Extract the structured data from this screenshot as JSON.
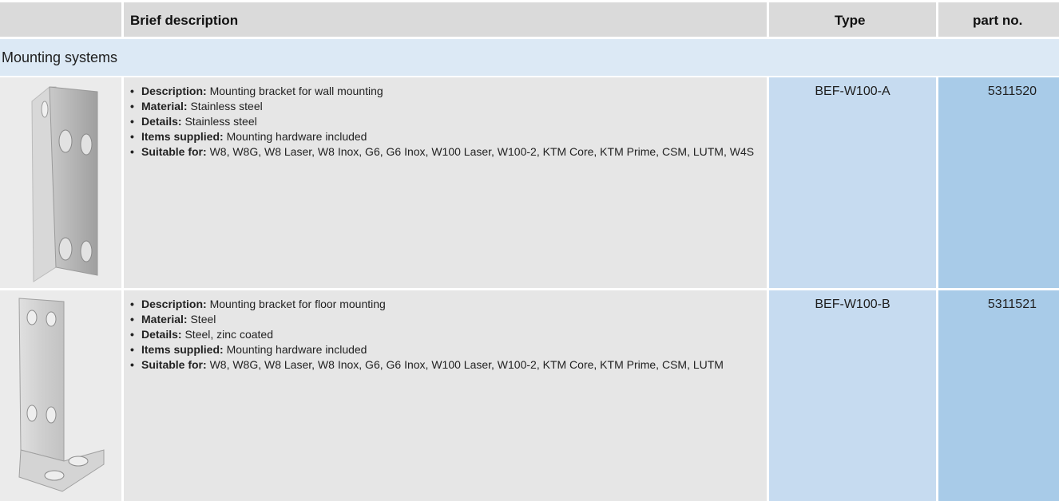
{
  "header": {
    "brief_description": "Brief description",
    "type": "Type",
    "part_no": "part no."
  },
  "section": {
    "title": "Mounting systems"
  },
  "products": [
    {
      "image": "wall-bracket-image",
      "specs": [
        {
          "label": "Description:",
          "value": "Mounting bracket for wall mounting"
        },
        {
          "label": "Material:",
          "value": "Stainless steel"
        },
        {
          "label": "Details:",
          "value": "Stainless steel"
        },
        {
          "label": "Items supplied:",
          "value": "Mounting hardware included"
        },
        {
          "label": "Suitable for:",
          "value": "W8, W8G, W8 Laser, W8 Inox, G6, G6 Inox, W100 Laser, W100-2, KTM Core, KTM Prime, CSM, LUTM, W4S"
        }
      ],
      "type": "BEF-W100-A",
      "part_no": "5311520"
    },
    {
      "image": "floor-bracket-image",
      "specs": [
        {
          "label": "Description:",
          "value": "Mounting bracket for floor mounting"
        },
        {
          "label": "Material:",
          "value": "Steel"
        },
        {
          "label": "Details:",
          "value": "Steel, zinc coated"
        },
        {
          "label": "Items supplied:",
          "value": "Mounting hardware included"
        },
        {
          "label": "Suitable for:",
          "value": "W8, W8G, W8 Laser, W8 Inox, G6, G6 Inox, W100 Laser, W100-2, KTM Core, KTM Prime, CSM, LUTM"
        }
      ],
      "type": "BEF-W100-B",
      "part_no": "5311521"
    }
  ],
  "colors": {
    "header_bg": "#dadada",
    "section_bg": "#dce9f5",
    "type_col_bg": "#c6dbf0",
    "part_col_bg": "#a8cbe8"
  }
}
